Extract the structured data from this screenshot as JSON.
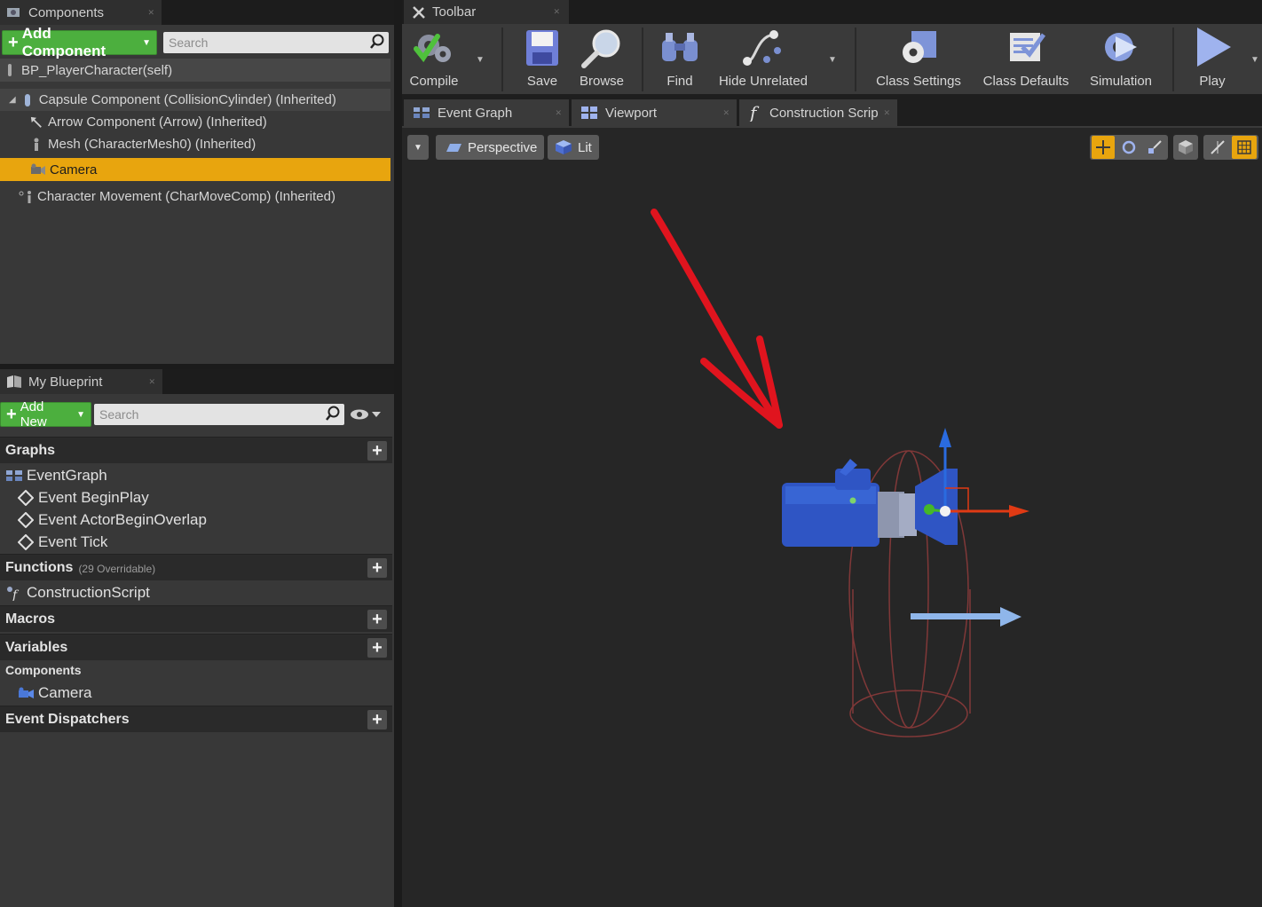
{
  "components_panel": {
    "tab_title": "Components",
    "add_component_label": "Add Component",
    "search_placeholder": "Search",
    "root_item": "BP_PlayerCharacter(self)",
    "tree": [
      {
        "label": "Capsule Component (CollisionCylinder) (Inherited)",
        "icon": "capsule-icon"
      },
      {
        "label": "Arrow Component (Arrow) (Inherited)",
        "icon": "arrow-component-icon"
      },
      {
        "label": "Mesh (CharacterMesh0) (Inherited)",
        "icon": "mesh-icon"
      },
      {
        "label": "Camera",
        "icon": "camera-icon",
        "selected": true
      },
      {
        "label": "Character Movement (CharMoveComp) (Inherited)",
        "icon": "movement-icon"
      }
    ]
  },
  "my_blueprint": {
    "tab_title": "My Blueprint",
    "add_new_label": "Add New",
    "search_placeholder": "Search",
    "sections": {
      "graphs": "Graphs",
      "functions": "Functions",
      "functions_sub": "(29 Overridable)",
      "macros": "Macros",
      "variables": "Variables",
      "event_dispatchers": "Event Dispatchers"
    },
    "graph_items": {
      "event_graph": "EventGraph",
      "begin_play": "Event BeginPlay",
      "actor_begin_overlap": "Event ActorBeginOverlap",
      "tick": "Event Tick"
    },
    "function_items": {
      "construction_script": "ConstructionScript"
    },
    "variable_category": "Components",
    "variable_items": {
      "camera": "Camera"
    }
  },
  "toolbar": {
    "tab_title": "Toolbar",
    "buttons": {
      "compile": "Compile",
      "save": "Save",
      "browse": "Browse",
      "find": "Find",
      "hide_unrelated": "Hide Unrelated",
      "class_settings": "Class Settings",
      "class_defaults": "Class Defaults",
      "simulation": "Simulation",
      "play": "Play"
    }
  },
  "document_tabs": {
    "event_graph": "Event Graph",
    "viewport": "Viewport",
    "construction_script": "Construction Scrip"
  },
  "viewport": {
    "perspective_label": "Perspective",
    "lit_label": "Lit"
  },
  "colors": {
    "selection": "#e8a50e",
    "add_button": "#4caf3e",
    "annotation_arrow": "#e0141e",
    "gizmo_x": "#e03a14",
    "gizmo_y": "#45b828",
    "gizmo_z": "#2a6be0",
    "camera_body": "#2f55c4"
  }
}
